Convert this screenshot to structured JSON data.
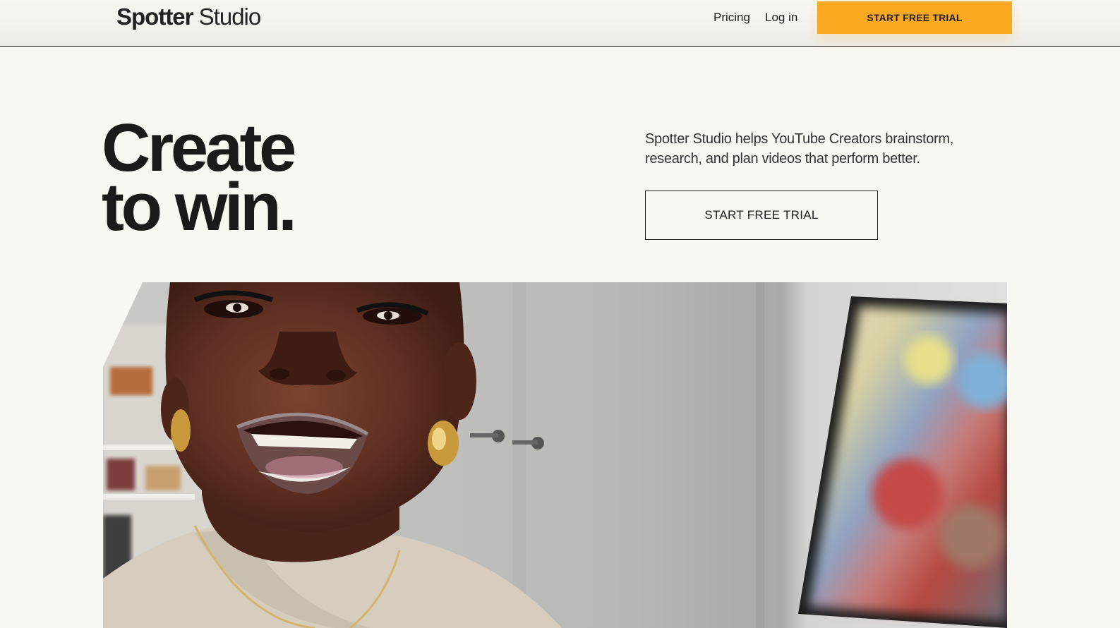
{
  "header": {
    "logo_brand": "Spotter",
    "logo_sub": " Studio",
    "nav": {
      "pricing": "Pricing",
      "login": "Log in"
    },
    "cta_label": "START FREE TRIAL",
    "cta_color": "#fba920"
  },
  "hero": {
    "headline_line1": "Create",
    "headline_line2": "to win.",
    "subtext": "Spotter Studio helps YouTube Creators brainstorm, research, and plan videos that perform better.",
    "cta_label": "START FREE TRIAL",
    "image_alt": "creator-speaking-to-camera"
  },
  "colors": {
    "background": "#f8f8f3",
    "text": "#1c1c1c",
    "accent": "#fba920"
  }
}
